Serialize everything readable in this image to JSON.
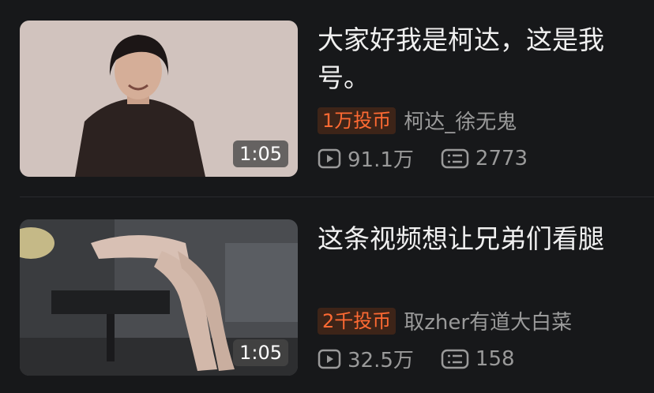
{
  "videos": [
    {
      "duration": "1:05",
      "title_line1": "大家好我是柯达，这是我",
      "title_line2": "号。",
      "coin_badge": "1万投币",
      "uploader": "柯达_徐无鬼",
      "plays": "91.1万",
      "danmaku": "2773"
    },
    {
      "duration": "1:05",
      "title_line1": "这条视频想让兄弟们看腿",
      "title_line2": "",
      "coin_badge": "2千投币",
      "uploader": "取zher有道大白菜",
      "plays": "32.5万",
      "danmaku": "158"
    }
  ],
  "colors": {
    "background": "#17181a",
    "badge_text": "#ff6a33",
    "badge_bg": "#3d2418",
    "meta_text": "#9a9a9a"
  },
  "icons": {
    "plays": "play-count-icon",
    "danmaku": "danmaku-icon"
  }
}
